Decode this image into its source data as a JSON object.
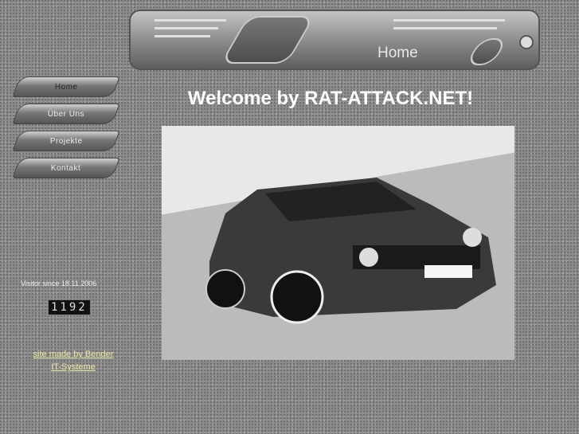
{
  "banner": {
    "title": "Home"
  },
  "nav": [
    {
      "label": "Home"
    },
    {
      "label": "Über Uns"
    },
    {
      "label": "Projekte"
    },
    {
      "label": "Kontakt"
    }
  ],
  "main": {
    "heading": "Welcome by RAT-ATTACK.NET!"
  },
  "sidebar": {
    "visitor_label": "Visitor since 18.11.2006",
    "counter": "1192",
    "credit_line1": "site made by Bender",
    "credit_line2": "IT-Systeme"
  }
}
